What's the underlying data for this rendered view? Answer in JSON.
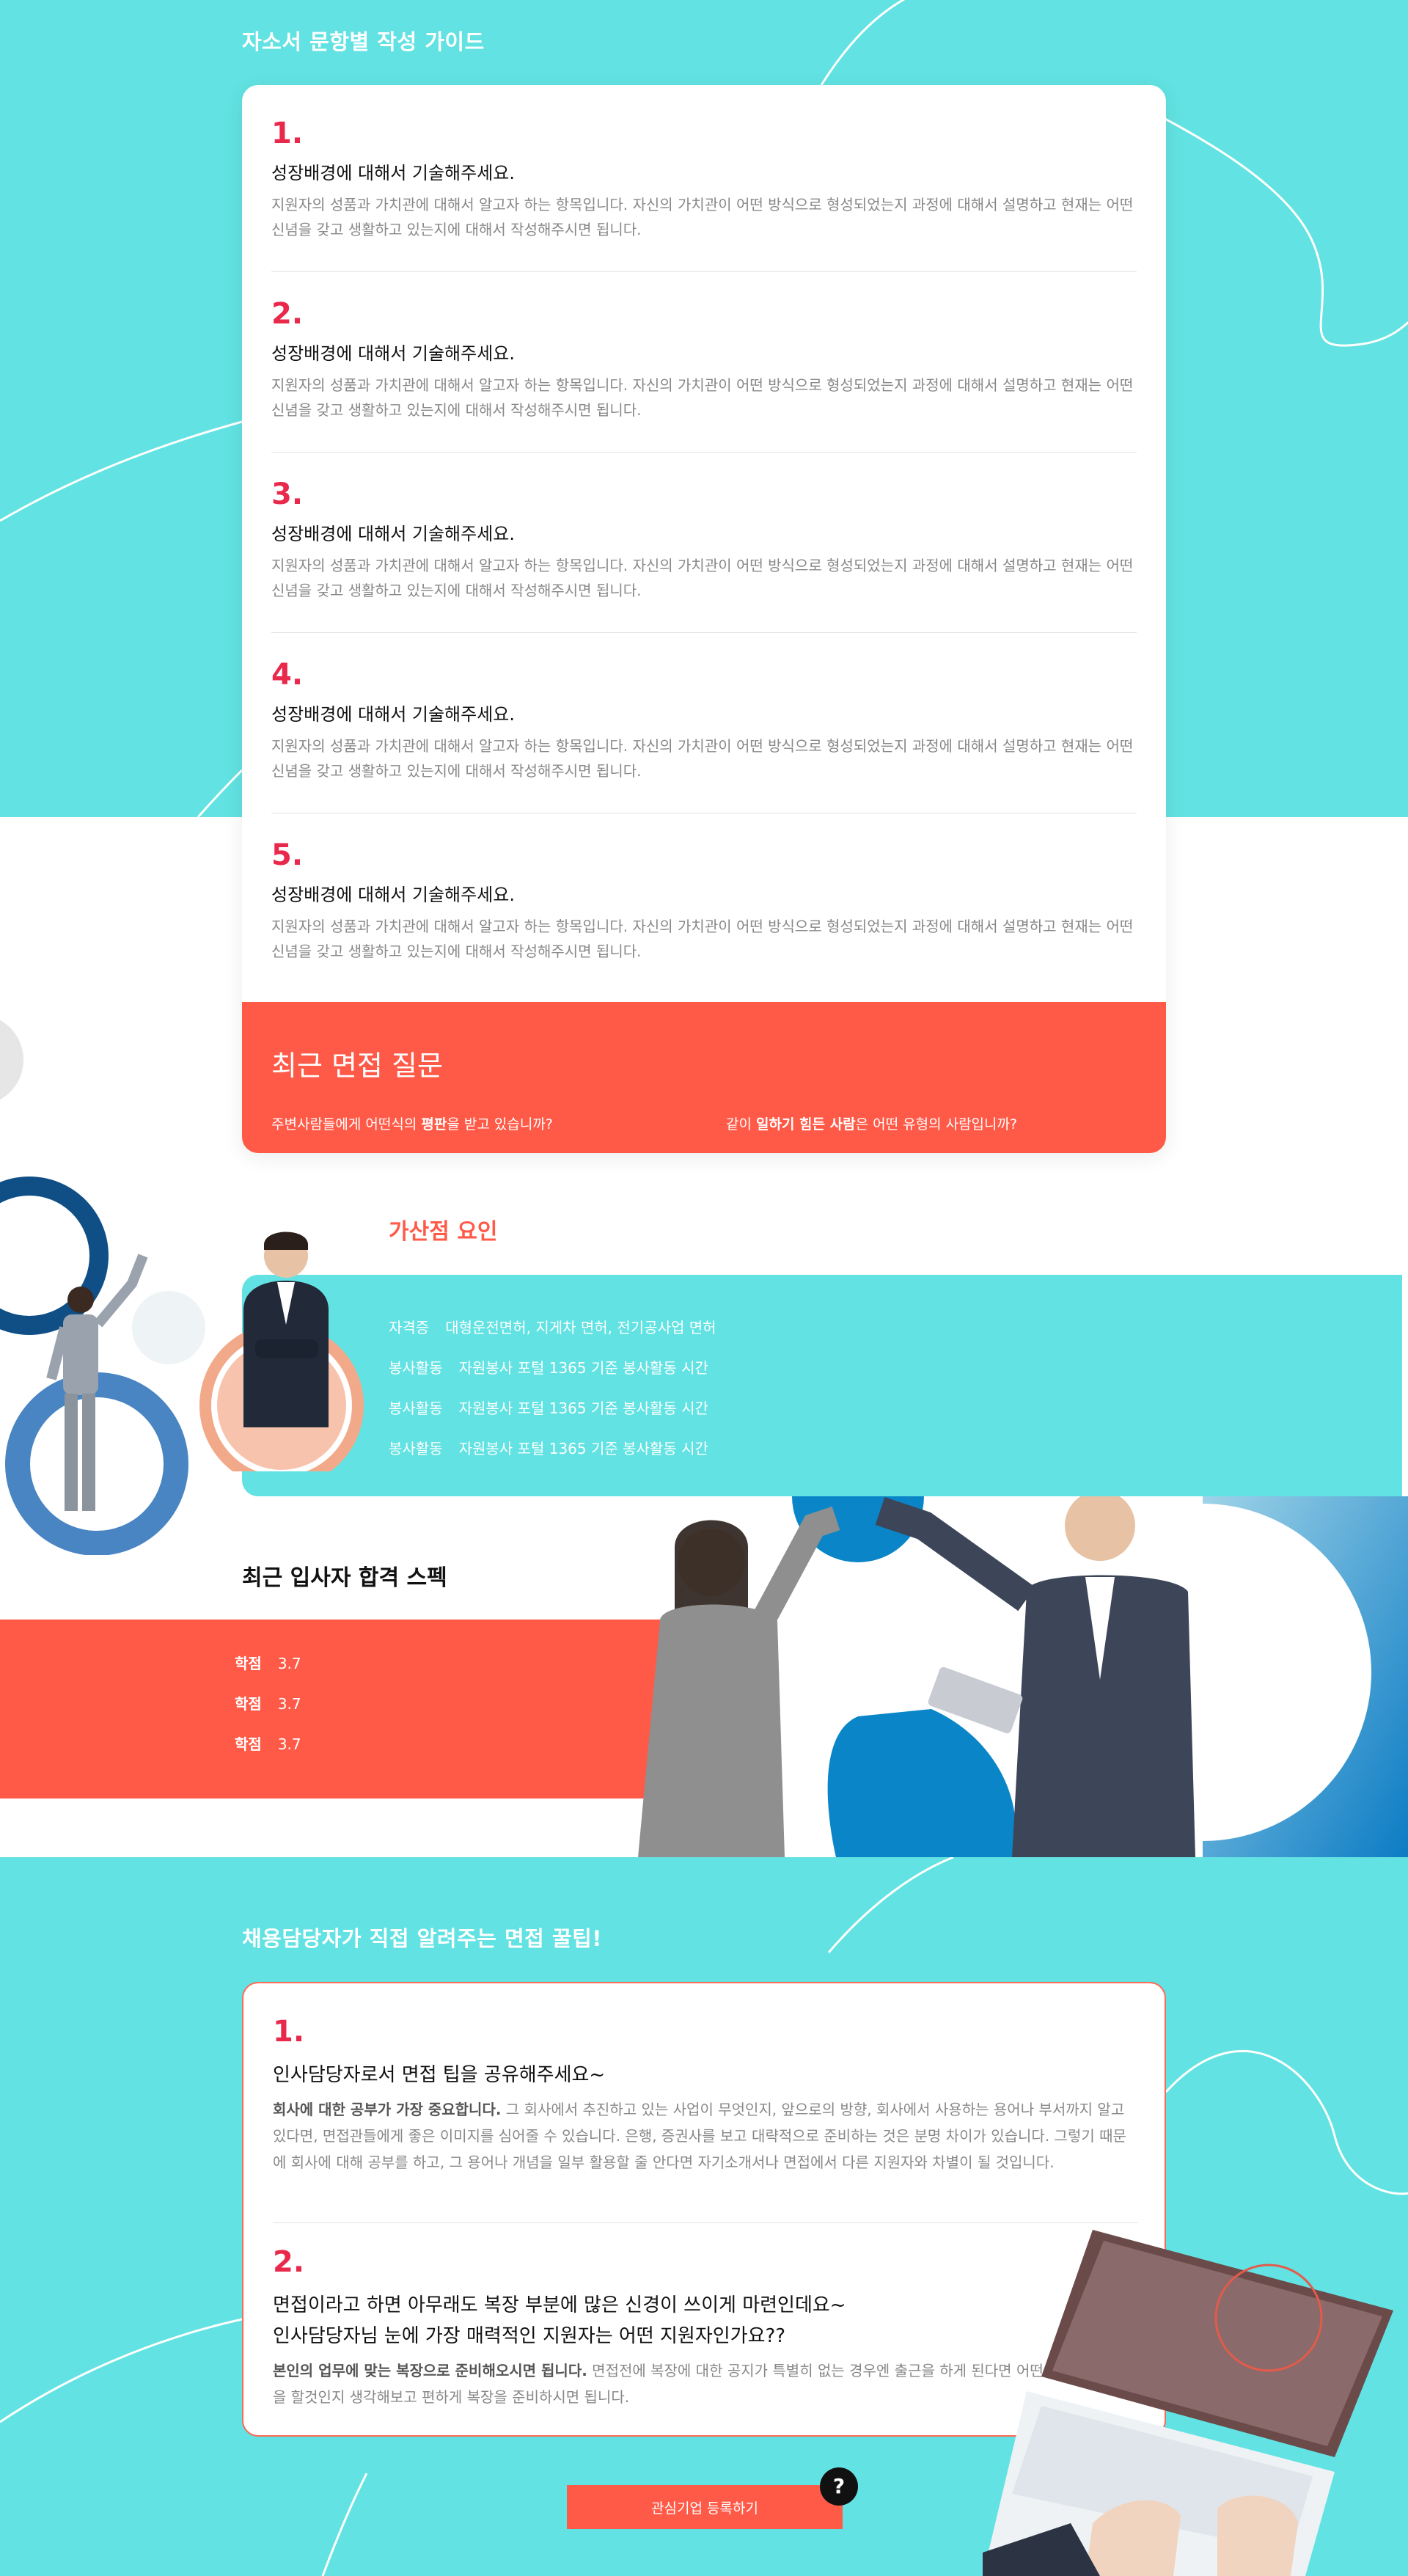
{
  "guide": {
    "title": "자소서 문항별 작성 가이드",
    "items": [
      {
        "num": "1.",
        "question": "성장배경에 대해서 기술해주세요.",
        "answer": "지원자의 성품과 가치관에 대해서 알고자 하는 항목입니다. 자신의 가치관이 어떤 방식으로 형성되었는지 과정에 대해서 설명하고 현재는 어떤 신념을 갖고 생활하고 있는지에 대해서 작성해주시면 됩니다."
      },
      {
        "num": "2.",
        "question": "성장배경에 대해서 기술해주세요.",
        "answer": "지원자의 성품과 가치관에 대해서 알고자 하는 항목입니다. 자신의 가치관이 어떤 방식으로 형성되었는지 과정에 대해서 설명하고 현재는 어떤 신념을 갖고 생활하고 있는지에 대해서 작성해주시면 됩니다."
      },
      {
        "num": "3.",
        "question": "성장배경에 대해서 기술해주세요.",
        "answer": "지원자의 성품과 가치관에 대해서 알고자 하는 항목입니다. 자신의 가치관이 어떤 방식으로 형성되었는지 과정에 대해서 설명하고 현재는 어떤 신념을 갖고 생활하고 있는지에 대해서 작성해주시면 됩니다."
      },
      {
        "num": "4.",
        "question": "성장배경에 대해서 기술해주세요.",
        "answer": "지원자의 성품과 가치관에 대해서 알고자 하는 항목입니다. 자신의 가치관이 어떤 방식으로 형성되었는지 과정에 대해서 설명하고 현재는 어떤 신념을 갖고 생활하고 있는지에 대해서 작성해주시면 됩니다."
      },
      {
        "num": "5.",
        "question": "성장배경에 대해서 기술해주세요.",
        "answer": "지원자의 성품과 가치관에 대해서 알고자 하는 항목입니다. 자신의 가치관이 어떤 방식으로 형성되었는지 과정에 대해서 설명하고 현재는 어떤 신념을 갖고 생활하고 있는지에 대해서 작성해주시면 됩니다."
      }
    ]
  },
  "interview": {
    "title": "최근 면접 질문",
    "q1_pre": "주변사람들에게 어떤식의 ",
    "q1_bold": "평판",
    "q1_post": "을 받고 있습니까?",
    "q2_pre": "같이 ",
    "q2_bold": "일하기 힘든 사람",
    "q2_post": "은 어떤 유형의 사람입니까?"
  },
  "bonus": {
    "title": "가산점 요인",
    "rows": [
      {
        "key": "자격증",
        "value": "대형운전면허, 지게차 면허, 전기공사업 면허"
      },
      {
        "key": "봉사활동",
        "value": "자원봉사 포털 1365 기준 봉사활동 시간"
      },
      {
        "key": "봉사활동",
        "value": "자원봉사 포털 1365 기준 봉사활동 시간"
      },
      {
        "key": "봉사활동",
        "value": "자원봉사 포털 1365 기준 봉사활동 시간"
      }
    ]
  },
  "spec": {
    "title": "최근 입사자 합격 스펙",
    "rows": [
      {
        "key": "학점",
        "value": "3.7"
      },
      {
        "key": "학점",
        "value": "3.7"
      },
      {
        "key": "학점",
        "value": "3.7"
      }
    ]
  },
  "tips": {
    "title": "채용담당자가 직접 알려주는 면접 꿀팁!",
    "items": [
      {
        "num": "1.",
        "question": "인사담당자로서 면접 팁을 공유해주세요~",
        "answer_bold": "회사에 대한 공부가 가장 중요합니다.",
        "answer": " 그 회사에서 추진하고 있는 사업이 무엇인지, 앞으로의 방향, 회사에서 사용하는 용어나 부서까지 알고 있다면, 면접관들에게 좋은 이미지를 심어줄 수 있습니다. 은행, 증권사를 보고 대략적으로 준비하는 것은 분명 차이가 있습니다. 그렇기 때문에 회사에 대해 공부를 하고, 그 용어나 개념을 일부 활용할 줄 안다면 자기소개서나 면접에서 다른 지원자와 차별이 될 것입니다."
      },
      {
        "num": "2.",
        "question": "면접이라고 하면 아무래도 복장 부분에 많은 신경이 쓰이게 마련인데요~",
        "question2": "인사담당자님 눈에 가장 매력적인 지원자는 어떤 지원자인가요??",
        "answer_bold": "본인의 업무에 맞는 복장으로 준비해오시면 됩니다.",
        "answer": " 면접전에 복장에 대한 공지가 특별히 없는 경우엔 출근을 하게 된다면 어떤 복장으로 출근을 할것인지 생각해보고 편하게 복장을 준비하시면 됩니다."
      }
    ]
  },
  "register_button": "관심기업 등록하기",
  "help_button": "?",
  "colors": {
    "teal": "#62e2e2",
    "coral": "#ff5a47",
    "number_red": "#e8294b"
  }
}
